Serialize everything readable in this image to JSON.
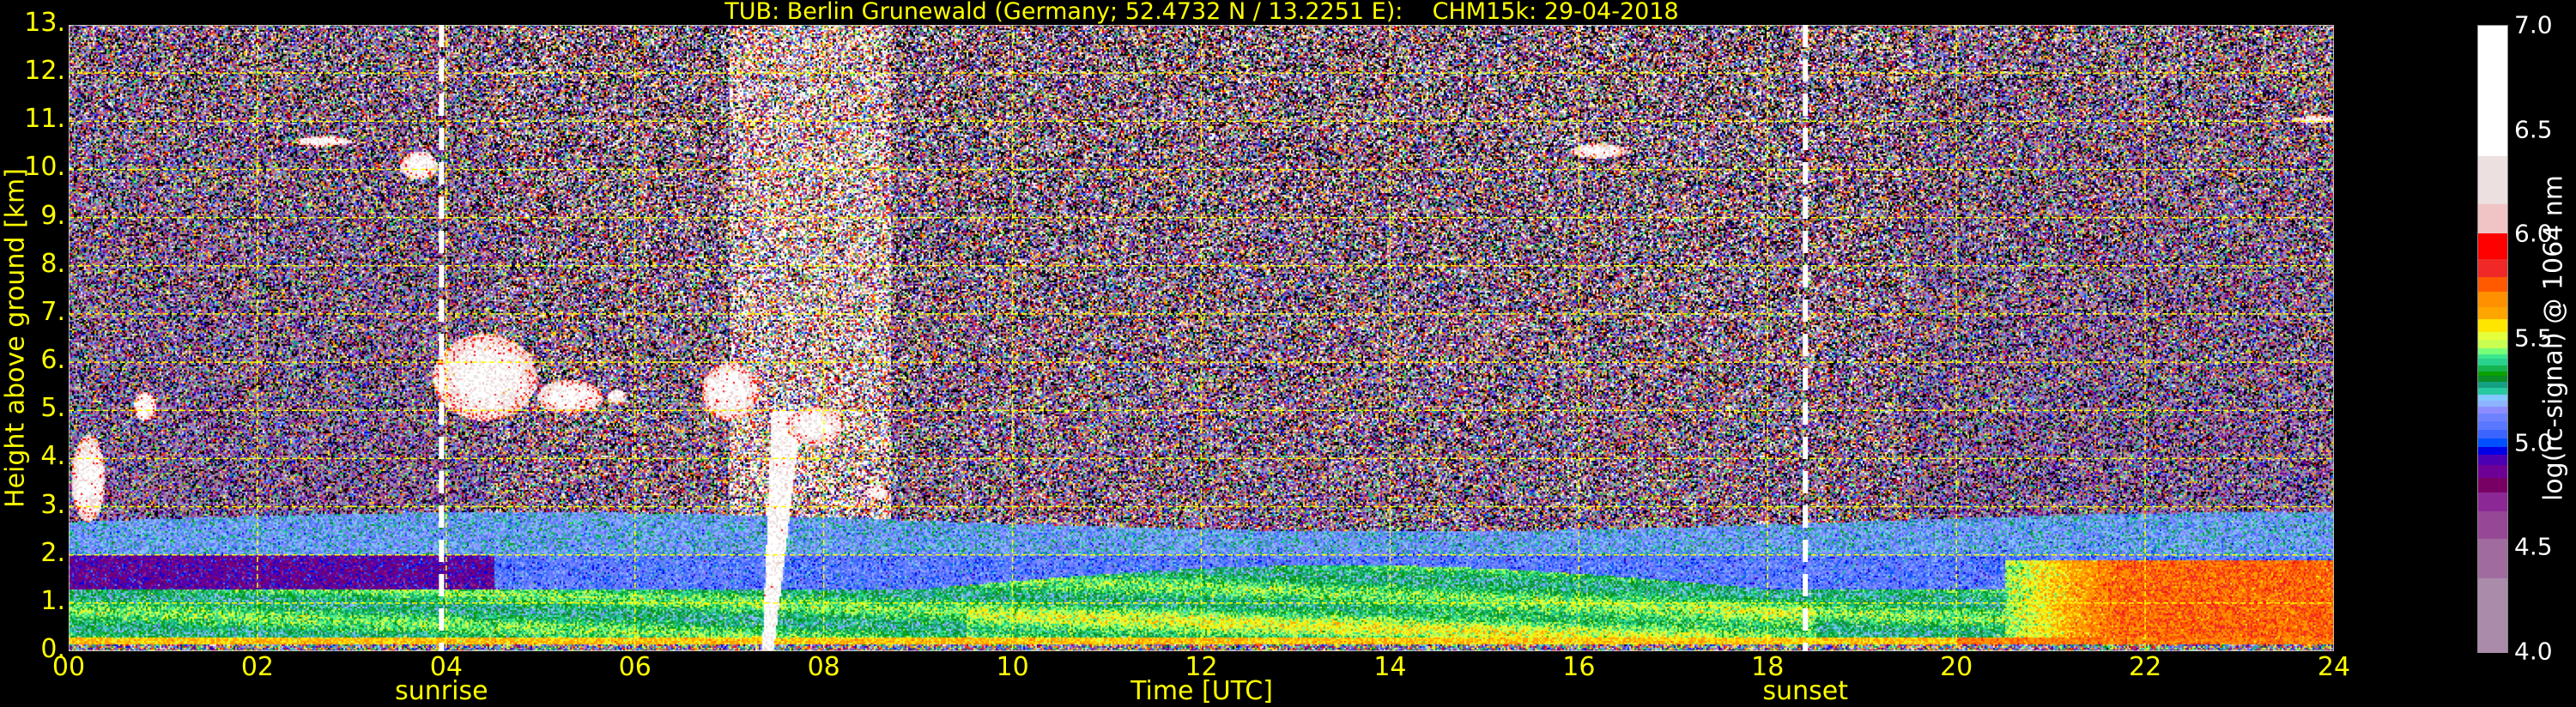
{
  "title": "TUB: Berlin Grunewald (Germany; 52.4732 N / 13.2251 E):    CHM15k: 29-04-2018",
  "chart_data": {
    "type": "heatmap",
    "title": "TUB: Berlin Grunewald (Germany; 52.4732 N / 13.2251 E):    CHM15k: 29-04-2018",
    "xlabel": "Time [UTC]",
    "ylabel": "Height above ground [km]",
    "xlim": [
      0,
      24
    ],
    "ylim": [
      0,
      13
    ],
    "x_ticks": [
      0,
      2,
      4,
      6,
      8,
      10,
      12,
      14,
      16,
      18,
      20,
      22,
      24
    ],
    "x_tick_labels": [
      "00",
      "02",
      "04",
      "06",
      "08",
      "10",
      "12",
      "14",
      "16",
      "18",
      "20",
      "22",
      "24"
    ],
    "y_ticks": [
      0,
      1,
      2,
      3,
      4,
      5,
      6,
      7,
      8,
      9,
      10,
      11,
      12,
      13
    ],
    "y_tick_labels": [
      "0.",
      "1.",
      "2.",
      "3.",
      "4.",
      "5.",
      "6.",
      "7.",
      "8.",
      "9.",
      "10.",
      "11.",
      "12.",
      "13."
    ],
    "grid": true,
    "grid_color": "#ffff00",
    "annotations": [
      {
        "label": "sunrise",
        "time": 3.95
      },
      {
        "label": "sunset",
        "time": 18.4
      }
    ],
    "colorbar": {
      "label": "log(rc-signal) @ 1064 nm",
      "range": [
        4.0,
        7.0
      ],
      "ticks": [
        4.0,
        4.5,
        5.0,
        5.5,
        6.0,
        6.5,
        7.0
      ],
      "tick_labels": [
        "4.0",
        "4.5",
        "5.0",
        "5.5",
        "6.0",
        "6.5",
        "7.0"
      ],
      "bounds": [
        4.0,
        4.36,
        4.55,
        4.68,
        4.77,
        4.84,
        4.9,
        4.95,
        4.99,
        5.03,
        5.07,
        5.11,
        5.15,
        5.18,
        5.21,
        5.24,
        5.27,
        5.3,
        5.33,
        5.35,
        5.38,
        5.41,
        5.43,
        5.46,
        5.5,
        5.54,
        5.6,
        5.66,
        5.73,
        5.8,
        5.89,
        6.01,
        6.15,
        6.38,
        7.0
      ],
      "colors": [
        "#aa8caa",
        "#a06ca0",
        "#964896",
        "#8c2896",
        "#780064",
        "#6e0096",
        "#4b00b4",
        "#0000e6",
        "#0050ff",
        "#3c64ff",
        "#5a78ff",
        "#6e82ff",
        "#8c8cff",
        "#8cb4ff",
        "#82c8ff",
        "#28c8a0",
        "#14a082",
        "#0a8c28",
        "#0aa000",
        "#14b450",
        "#28d28c",
        "#3ce68c",
        "#78ff78",
        "#c8ff50",
        "#e6ff3c",
        "#ffe600",
        "#ffa500",
        "#ff9100",
        "#ff5a00",
        "#f02828",
        "#ff0000",
        "#f0c4c4",
        "#ece0e0",
        "#ffffff"
      ],
      "below_range_color": "#000000"
    }
  }
}
